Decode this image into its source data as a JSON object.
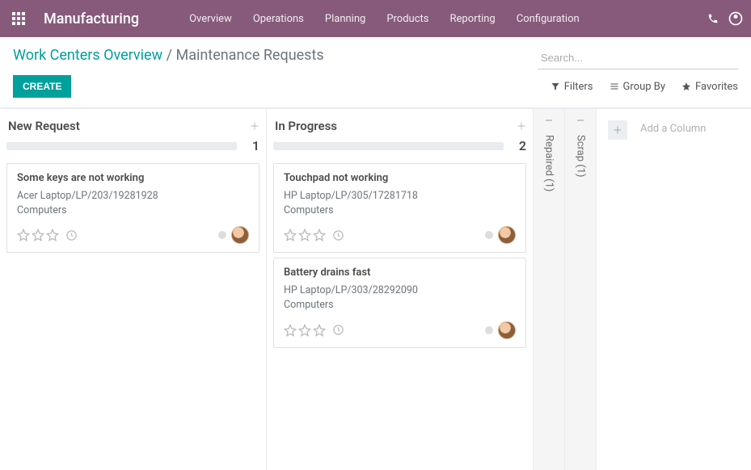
{
  "brand": "Manufacturing",
  "nav": {
    "items": [
      "Overview",
      "Operations",
      "Planning",
      "Products",
      "Reporting",
      "Configuration"
    ]
  },
  "breadcrumb": {
    "parent": "Work Centers Overview",
    "current": "Maintenance Requests",
    "sep": "/"
  },
  "search": {
    "placeholder": "Search..."
  },
  "buttons": {
    "create": "Create"
  },
  "filters": {
    "filters": "Filters",
    "groupby": "Group By",
    "favorites": "Favorites"
  },
  "add_column": "Add a Column",
  "columns": [
    {
      "title": "New Request",
      "count": "1",
      "cards": [
        {
          "title": "Some keys are not working",
          "line1": "Acer Laptop/LP/203/19281928",
          "line2": "Computers"
        }
      ]
    },
    {
      "title": "In Progress",
      "count": "2",
      "cards": [
        {
          "title": "Touchpad not working",
          "line1": "HP Laptop/LP/305/17281718",
          "line2": "Computers"
        },
        {
          "title": "Battery drains fast",
          "line1": "HP Laptop/LP/303/28292090",
          "line2": "Computers"
        }
      ]
    }
  ],
  "folded_columns": [
    {
      "title": "Repaired (1)"
    },
    {
      "title": "Scrap (1)"
    }
  ]
}
